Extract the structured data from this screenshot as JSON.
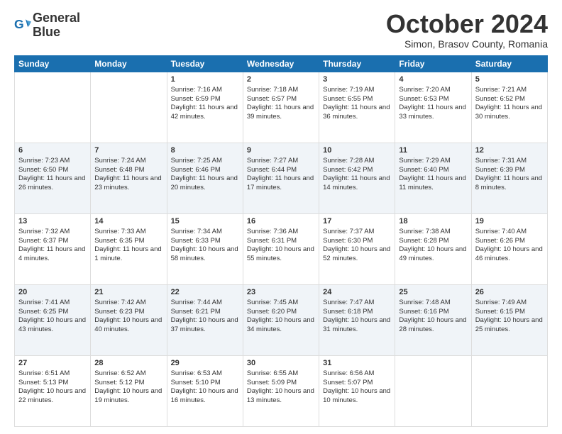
{
  "header": {
    "logo_line1": "General",
    "logo_line2": "Blue",
    "month": "October 2024",
    "location": "Simon, Brasov County, Romania"
  },
  "days_of_week": [
    "Sunday",
    "Monday",
    "Tuesday",
    "Wednesday",
    "Thursday",
    "Friday",
    "Saturday"
  ],
  "weeks": [
    [
      {
        "day": "",
        "info": ""
      },
      {
        "day": "",
        "info": ""
      },
      {
        "day": "1",
        "info": "Sunrise: 7:16 AM\nSunset: 6:59 PM\nDaylight: 11 hours and 42 minutes."
      },
      {
        "day": "2",
        "info": "Sunrise: 7:18 AM\nSunset: 6:57 PM\nDaylight: 11 hours and 39 minutes."
      },
      {
        "day": "3",
        "info": "Sunrise: 7:19 AM\nSunset: 6:55 PM\nDaylight: 11 hours and 36 minutes."
      },
      {
        "day": "4",
        "info": "Sunrise: 7:20 AM\nSunset: 6:53 PM\nDaylight: 11 hours and 33 minutes."
      },
      {
        "day": "5",
        "info": "Sunrise: 7:21 AM\nSunset: 6:52 PM\nDaylight: 11 hours and 30 minutes."
      }
    ],
    [
      {
        "day": "6",
        "info": "Sunrise: 7:23 AM\nSunset: 6:50 PM\nDaylight: 11 hours and 26 minutes."
      },
      {
        "day": "7",
        "info": "Sunrise: 7:24 AM\nSunset: 6:48 PM\nDaylight: 11 hours and 23 minutes."
      },
      {
        "day": "8",
        "info": "Sunrise: 7:25 AM\nSunset: 6:46 PM\nDaylight: 11 hours and 20 minutes."
      },
      {
        "day": "9",
        "info": "Sunrise: 7:27 AM\nSunset: 6:44 PM\nDaylight: 11 hours and 17 minutes."
      },
      {
        "day": "10",
        "info": "Sunrise: 7:28 AM\nSunset: 6:42 PM\nDaylight: 11 hours and 14 minutes."
      },
      {
        "day": "11",
        "info": "Sunrise: 7:29 AM\nSunset: 6:40 PM\nDaylight: 11 hours and 11 minutes."
      },
      {
        "day": "12",
        "info": "Sunrise: 7:31 AM\nSunset: 6:39 PM\nDaylight: 11 hours and 8 minutes."
      }
    ],
    [
      {
        "day": "13",
        "info": "Sunrise: 7:32 AM\nSunset: 6:37 PM\nDaylight: 11 hours and 4 minutes."
      },
      {
        "day": "14",
        "info": "Sunrise: 7:33 AM\nSunset: 6:35 PM\nDaylight: 11 hours and 1 minute."
      },
      {
        "day": "15",
        "info": "Sunrise: 7:34 AM\nSunset: 6:33 PM\nDaylight: 10 hours and 58 minutes."
      },
      {
        "day": "16",
        "info": "Sunrise: 7:36 AM\nSunset: 6:31 PM\nDaylight: 10 hours and 55 minutes."
      },
      {
        "day": "17",
        "info": "Sunrise: 7:37 AM\nSunset: 6:30 PM\nDaylight: 10 hours and 52 minutes."
      },
      {
        "day": "18",
        "info": "Sunrise: 7:38 AM\nSunset: 6:28 PM\nDaylight: 10 hours and 49 minutes."
      },
      {
        "day": "19",
        "info": "Sunrise: 7:40 AM\nSunset: 6:26 PM\nDaylight: 10 hours and 46 minutes."
      }
    ],
    [
      {
        "day": "20",
        "info": "Sunrise: 7:41 AM\nSunset: 6:25 PM\nDaylight: 10 hours and 43 minutes."
      },
      {
        "day": "21",
        "info": "Sunrise: 7:42 AM\nSunset: 6:23 PM\nDaylight: 10 hours and 40 minutes."
      },
      {
        "day": "22",
        "info": "Sunrise: 7:44 AM\nSunset: 6:21 PM\nDaylight: 10 hours and 37 minutes."
      },
      {
        "day": "23",
        "info": "Sunrise: 7:45 AM\nSunset: 6:20 PM\nDaylight: 10 hours and 34 minutes."
      },
      {
        "day": "24",
        "info": "Sunrise: 7:47 AM\nSunset: 6:18 PM\nDaylight: 10 hours and 31 minutes."
      },
      {
        "day": "25",
        "info": "Sunrise: 7:48 AM\nSunset: 6:16 PM\nDaylight: 10 hours and 28 minutes."
      },
      {
        "day": "26",
        "info": "Sunrise: 7:49 AM\nSunset: 6:15 PM\nDaylight: 10 hours and 25 minutes."
      }
    ],
    [
      {
        "day": "27",
        "info": "Sunrise: 6:51 AM\nSunset: 5:13 PM\nDaylight: 10 hours and 22 minutes."
      },
      {
        "day": "28",
        "info": "Sunrise: 6:52 AM\nSunset: 5:12 PM\nDaylight: 10 hours and 19 minutes."
      },
      {
        "day": "29",
        "info": "Sunrise: 6:53 AM\nSunset: 5:10 PM\nDaylight: 10 hours and 16 minutes."
      },
      {
        "day": "30",
        "info": "Sunrise: 6:55 AM\nSunset: 5:09 PM\nDaylight: 10 hours and 13 minutes."
      },
      {
        "day": "31",
        "info": "Sunrise: 6:56 AM\nSunset: 5:07 PM\nDaylight: 10 hours and 10 minutes."
      },
      {
        "day": "",
        "info": ""
      },
      {
        "day": "",
        "info": ""
      }
    ]
  ]
}
